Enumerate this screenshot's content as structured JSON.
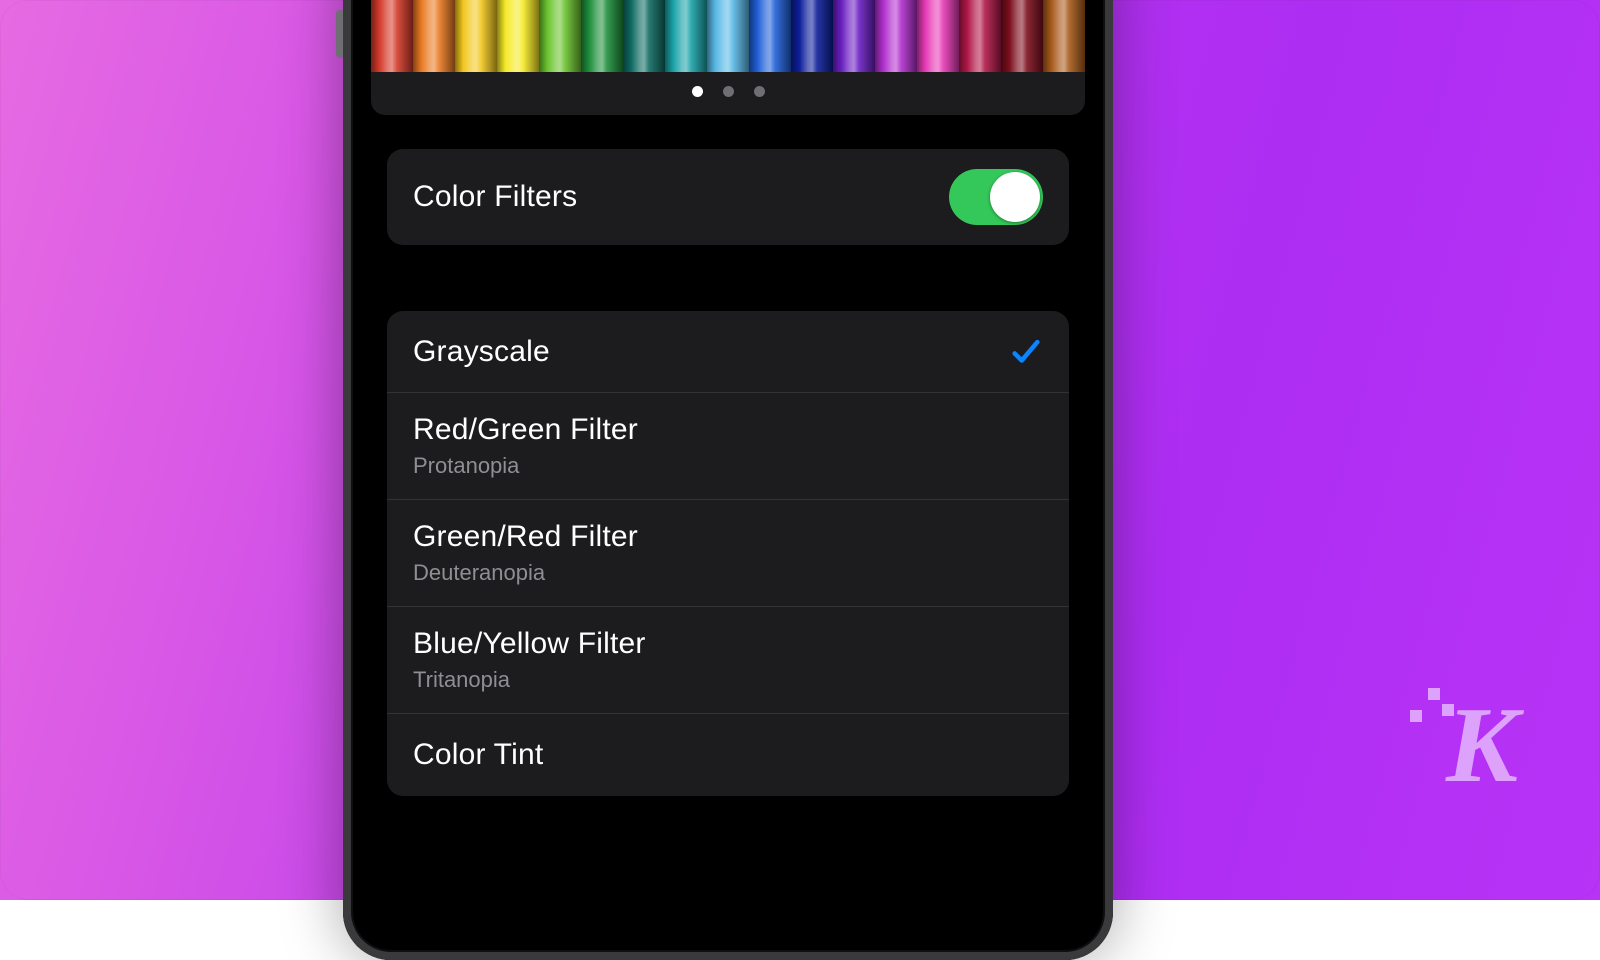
{
  "preview": {
    "pencil_colors": [
      "#d43a2a",
      "#ea7a22",
      "#f3c81f",
      "#f6ea25",
      "#6ac22e",
      "#1e8f3b",
      "#0f6b63",
      "#1aa3a8",
      "#58b8e6",
      "#1f5fd8",
      "#0c1e9a",
      "#6a1ec2",
      "#b12fce",
      "#e73ab6",
      "#b11747",
      "#7d0e1d",
      "#a85a1b"
    ],
    "page_dots": {
      "count": 3,
      "active_index": 0
    }
  },
  "toggle_row": {
    "label": "Color Filters",
    "enabled": true
  },
  "filter_options": [
    {
      "title": "Grayscale",
      "subtitle": "",
      "selected": true
    },
    {
      "title": "Red/Green Filter",
      "subtitle": "Protanopia",
      "selected": false
    },
    {
      "title": "Green/Red Filter",
      "subtitle": "Deuteranopia",
      "selected": false
    },
    {
      "title": "Blue/Yellow Filter",
      "subtitle": "Tritanopia",
      "selected": false
    },
    {
      "title": "Color Tint",
      "subtitle": "",
      "selected": false
    }
  ],
  "accent_color": "#0a84ff",
  "watermark": "K"
}
